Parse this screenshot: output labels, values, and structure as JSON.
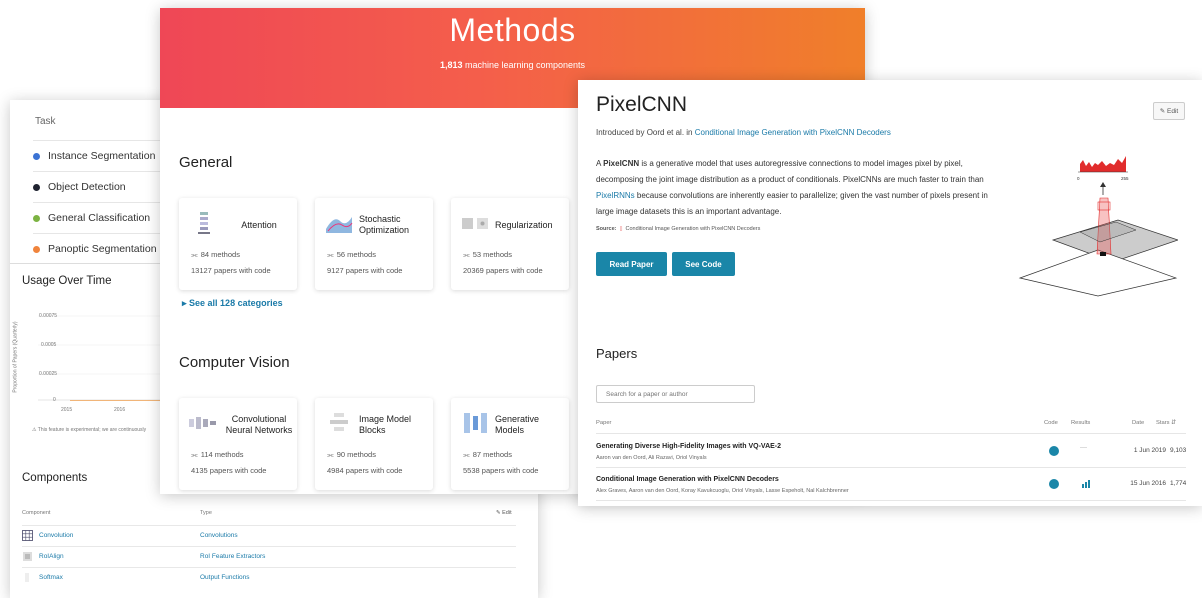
{
  "back": {
    "task_header": "Task",
    "tasks": [
      {
        "label": "Instance Segmentation",
        "color": "#3b73d4"
      },
      {
        "label": "Object Detection",
        "color": "#1f2330"
      },
      {
        "label": "General Classification",
        "color": "#7cb342"
      },
      {
        "label": "Panoptic Segmentation",
        "color": "#f0843c"
      }
    ],
    "usage_title": "Usage Over Time",
    "usage_ylabel": "Proportion of Papers (Quarterly)",
    "usage_yticks": [
      "0.00075",
      "0.0005",
      "0.00025",
      "0"
    ],
    "usage_xticks": [
      "2015",
      "2016"
    ],
    "usage_note": "⚠ This feature is experimental; we are continuously",
    "components_title": "Components",
    "components_head": {
      "component": "Component",
      "type": "Type",
      "edit": "✎ Edit"
    },
    "components": [
      {
        "name": "Convolution",
        "type": "Convolutions"
      },
      {
        "name": "RoIAlign",
        "type": "RoI Feature Extractors"
      },
      {
        "name": "Softmax",
        "type": "Output Functions"
      }
    ]
  },
  "methods": {
    "title": "Methods",
    "subtitle_count": "1,813",
    "subtitle_rest": " machine learning components",
    "general_title": "General",
    "general": [
      {
        "name": "Attention",
        "methods": "84 methods",
        "papers": "13127 papers with code"
      },
      {
        "name": "Stochastic Optimization",
        "methods": "56 methods",
        "papers": "9127 papers with code"
      },
      {
        "name": "Regularization",
        "methods": "53 methods",
        "papers": "20369 papers with code"
      }
    ],
    "see_all": "See all 128 categories",
    "cv_title": "Computer Vision",
    "cv": [
      {
        "name": "Convolutional Neural Networks",
        "methods": "114 methods",
        "papers": "4135 papers with code"
      },
      {
        "name": "Image Model Blocks",
        "methods": "90 methods",
        "papers": "4984 papers with code"
      },
      {
        "name": "Generative Models",
        "methods": "87 methods",
        "papers": "5538 papers with code"
      }
    ]
  },
  "pixelcnn": {
    "title": "PixelCNN",
    "edit": "✎ Edit",
    "intro_prefix": "Introduced by Oord et al. in ",
    "intro_link": "Conditional Image Generation with PixelCNN Decoders",
    "desc_a": "A ",
    "desc_bold": "PixelCNN",
    "desc_b": " is a generative model that uses autoregressive connections to model images pixel by pixel, decomposing the joint image distribution as a product of conditionals. PixelCNNs are much faster to train than ",
    "desc_link": "PixelRNNs",
    "desc_c": " because convolutions are inherently easier to parallelize; given the vast number of pixels present in large image datasets this is an important advantage.",
    "source_label": "Source:",
    "source_text": "Conditional Image Generation with PixelCNN Decoders",
    "read_paper": "Read Paper",
    "see_code": "See Code",
    "figure_ticks": [
      "0",
      "255"
    ],
    "papers_title": "Papers",
    "search_placeholder": "Search for a paper or author",
    "table_head": {
      "paper": "Paper",
      "code": "Code",
      "results": "Results",
      "date": "Date",
      "stars": "Stars ⇵"
    },
    "papers": [
      {
        "title": "Generating Diverse High-Fidelity Images with VQ-VAE-2",
        "authors": "Aaron van den Oord, Ali Razavi, Oriol Vinyals",
        "results": "—",
        "date": "1 Jun 2019",
        "stars": "9,103"
      },
      {
        "title": "Conditional Image Generation with PixelCNN Decoders",
        "authors": "Alex Graves, Aaron van den Oord, Koray Kavukcuoglu, Oriol Vinyals, Lasse Espeholt, Nal Kalchbrenner",
        "results": "",
        "date": "15 Jun 2016",
        "stars": "1,774"
      }
    ]
  },
  "colors": {
    "accent": "#1a86a8",
    "banner_start": "#ef4756",
    "banner_end": "#f07f2a"
  }
}
